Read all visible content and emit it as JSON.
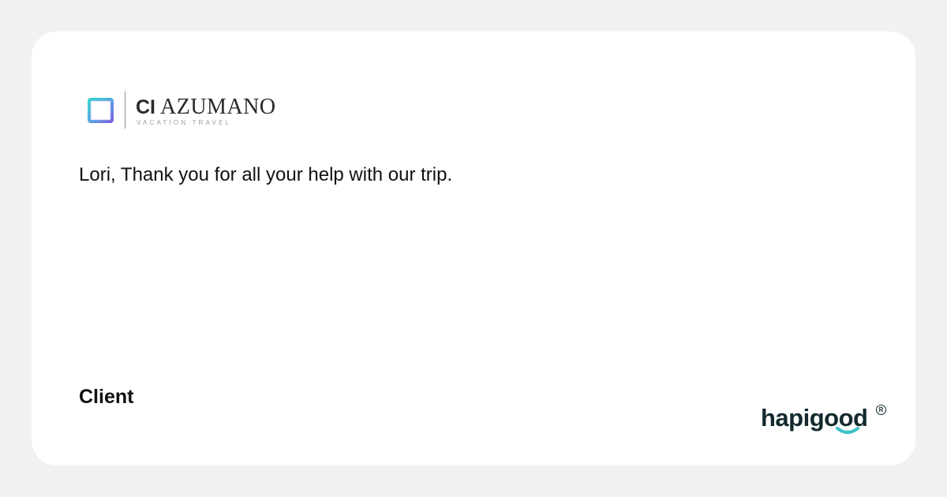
{
  "logo": {
    "name_prefix": "CI",
    "name": "AZUMANO",
    "tagline": "VACATION TRAVEL"
  },
  "testimonial": {
    "quote": "Lori, Thank you for all your help with our trip.",
    "author": "Client"
  },
  "brand": {
    "name": "hapigood",
    "registered": "R"
  },
  "colors": {
    "background": "#f1f2f0",
    "card": "#ffffff",
    "text": "#111111",
    "brand_dark": "#122a2d",
    "brand_accent": "#3cc3c8"
  },
  "icons": {
    "logo_mark": "square-frame-icon",
    "smile": "smile-icon"
  }
}
